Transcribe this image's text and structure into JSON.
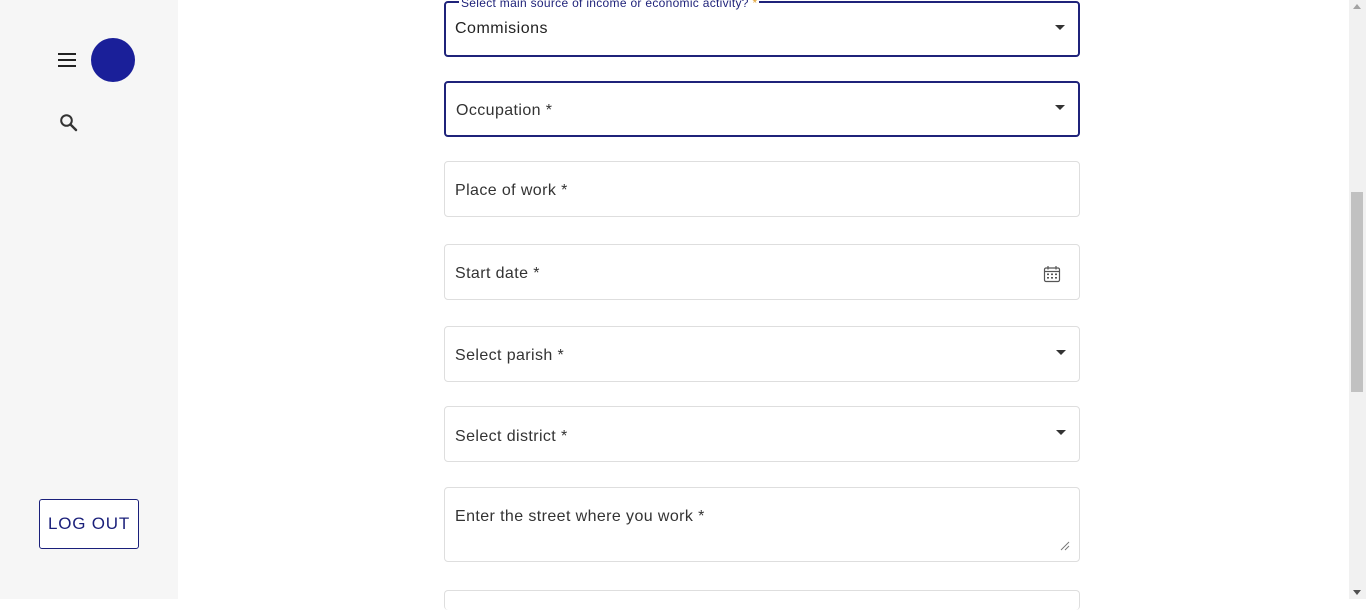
{
  "sidebar": {
    "menu_icon": "hamburger-menu-icon",
    "avatar_color": "#1a1f99",
    "search_icon": "search-icon",
    "logout_label": "LOG OUT"
  },
  "form": {
    "income_source": {
      "label": "Select main source of income or economic activity?",
      "required_mark": "*",
      "value": "Commisions"
    },
    "occupation": {
      "label": "Occupation *"
    },
    "place_of_work": {
      "label": "Place of work *"
    },
    "start_date": {
      "label": "Start date *",
      "icon": "calendar-icon"
    },
    "parish": {
      "label": "Select parish *"
    },
    "district": {
      "label": "Select district *"
    },
    "street": {
      "label": "Enter the street where you work *"
    }
  },
  "colors": {
    "accent": "#1f237a",
    "required_mark": "#e0a030",
    "sidebar_bg": "#f6f6f6"
  }
}
